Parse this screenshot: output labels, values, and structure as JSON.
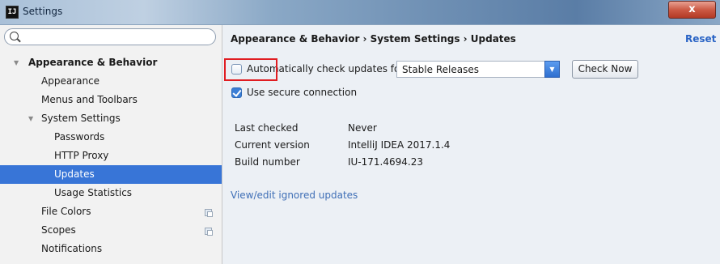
{
  "window": {
    "title": "Settings",
    "app_icon": "IJ",
    "close_glyph": "x"
  },
  "search": {
    "placeholder": ""
  },
  "sidebar": {
    "items": [
      {
        "label": "Appearance & Behavior",
        "expanded": true
      },
      {
        "label": "Appearance"
      },
      {
        "label": "Menus and Toolbars"
      },
      {
        "label": "System Settings",
        "expanded": true
      },
      {
        "label": "Passwords"
      },
      {
        "label": "HTTP Proxy"
      },
      {
        "label": "Updates",
        "selected": true
      },
      {
        "label": "Usage Statistics"
      },
      {
        "label": "File Colors",
        "project_icon": "project-scope-icon"
      },
      {
        "label": "Scopes",
        "project_icon": "project-scope-icon"
      },
      {
        "label": "Notifications"
      }
    ]
  },
  "main": {
    "breadcrumb": "Appearance & Behavior › System Settings › Updates",
    "reset_label": "Reset",
    "auto_check": {
      "label": "Automatically check updates for",
      "checked": false
    },
    "channel_select": {
      "value": "Stable Releases"
    },
    "check_now_label": "Check Now",
    "secure_connection": {
      "label": "Use secure connection",
      "checked": true
    },
    "info": [
      {
        "key": "Last checked",
        "value": "Never"
      },
      {
        "key": "Current version",
        "value": "IntelliJ IDEA 2017.1.4"
      },
      {
        "key": "Build number",
        "value": "IU-171.4694.23"
      }
    ],
    "ignored_link": "View/edit ignored updates"
  },
  "colors": {
    "accent": "#3875d7",
    "link": "#3f6fb6",
    "highlight": "#e01d22",
    "panel_bg": "#ecf0f5",
    "sidebar_bg": "#f2f2f2"
  }
}
